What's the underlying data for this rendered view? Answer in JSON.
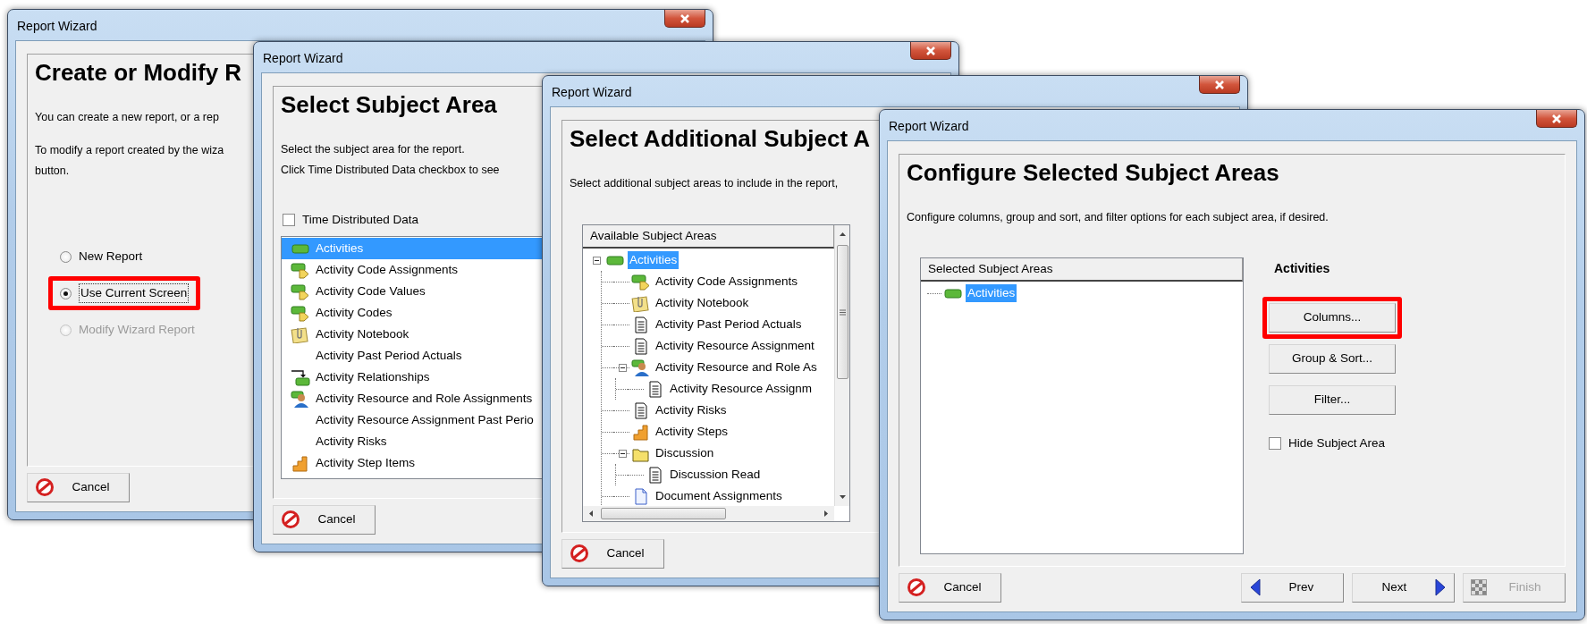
{
  "windows": [
    {
      "kind": "options",
      "title": "Report Wizard",
      "heading": "Create or Modify R",
      "paragraphs": [
        {
          "lines": [
            "You can create a new report, or a rep"
          ]
        },
        {
          "lines": [
            "To modify a report created by the wiza",
            "button."
          ]
        }
      ],
      "options": [
        {
          "label": "New Report",
          "selected": false,
          "disabled": false,
          "highlighted": false,
          "focused": false
        },
        {
          "label": "Use Current Screen",
          "selected": true,
          "disabled": false,
          "highlighted": true,
          "focused": true
        },
        {
          "label": "Modify Wizard Report",
          "selected": false,
          "disabled": true,
          "highlighted": false,
          "focused": false
        }
      ],
      "buttons": [
        {
          "kind": "cancel",
          "label": "Cancel",
          "disabled": false
        }
      ]
    },
    {
      "kind": "list",
      "title": "Report Wizard",
      "heading": "Select Subject Area",
      "paragraphs": [
        {
          "lines": [
            "Select the subject area for the report.",
            "Click Time Distributed Data checkbox to see"
          ]
        }
      ],
      "checkbox": {
        "label": "Time Distributed Data",
        "checked": false
      },
      "items": [
        {
          "label": "Activities",
          "kind": "activity",
          "selected": true
        },
        {
          "label": "Activity Code Assignments",
          "kind": "code",
          "selected": false
        },
        {
          "label": "Activity Code Values",
          "kind": "code",
          "selected": false
        },
        {
          "label": "Activity Codes",
          "kind": "code",
          "selected": false
        },
        {
          "label": "Activity Notebook",
          "kind": "notebook",
          "selected": false
        },
        {
          "label": "Activity Past Period Actuals",
          "kind": "plain",
          "selected": false
        },
        {
          "label": "Activity Relationships",
          "kind": "relationship",
          "selected": false
        },
        {
          "label": "Activity Resource and Role Assignments",
          "kind": "resource",
          "selected": false
        },
        {
          "label": "Activity Resource Assignment Past Perio",
          "kind": "plain",
          "selected": false
        },
        {
          "label": "Activity Risks",
          "kind": "plain",
          "selected": false
        },
        {
          "label": "Activity Step Items",
          "kind": "steps",
          "selected": false
        }
      ],
      "buttons": [
        {
          "kind": "cancel",
          "label": "Cancel",
          "disabled": false
        }
      ]
    },
    {
      "kind": "tree",
      "title": "Report Wizard",
      "heading": "Select Additional Subject A",
      "paragraphs": [
        {
          "lines": [
            "Select additional subject areas to include in the report,"
          ]
        }
      ],
      "tree": {
        "header": "Available Subject Areas",
        "nodes": [
          {
            "label": "Activities",
            "kind": "activity",
            "selected": true,
            "expanded": true,
            "children": [
              {
                "label": "Activity Code Assignments",
                "kind": "code",
                "selected": false
              },
              {
                "label": "Activity Notebook",
                "kind": "notebook",
                "selected": false
              },
              {
                "label": "Activity Past Period Actuals",
                "kind": "document",
                "selected": false
              },
              {
                "label": "Activity Resource Assignment",
                "kind": "document",
                "selected": false
              },
              {
                "label": "Activity Resource and Role As",
                "kind": "resource",
                "selected": false,
                "expanded": true,
                "children": [
                  {
                    "label": "Activity Resource Assignm",
                    "kind": "document",
                    "selected": false
                  }
                ]
              },
              {
                "label": "Activity Risks",
                "kind": "document",
                "selected": false
              },
              {
                "label": "Activity Steps",
                "kind": "steps",
                "selected": false
              },
              {
                "label": "Discussion",
                "kind": "folder",
                "selected": false,
                "expanded": true,
                "children": [
                  {
                    "label": "Discussion Read",
                    "kind": "document",
                    "selected": false
                  }
                ]
              },
              {
                "label": "Document Assignments",
                "kind": "assignment",
                "selected": false
              }
            ]
          }
        ]
      },
      "buttons": [
        {
          "kind": "cancel",
          "label": "Cancel",
          "disabled": false
        }
      ]
    },
    {
      "kind": "configure",
      "title": "Report Wizard",
      "heading": "Configure Selected Subject Areas",
      "paragraphs": [
        {
          "lines": [
            "Configure columns, group and sort, and filter options for each subject area, if desired."
          ]
        }
      ],
      "tree": {
        "header": "Selected Subject Areas",
        "nodes": [
          {
            "label": "Activities",
            "kind": "activity",
            "selected": true
          }
        ]
      },
      "subject": {
        "label": "Activities",
        "buttons": [
          {
            "label": "Columns...",
            "highlighted": true
          },
          {
            "label": "Group & Sort...",
            "highlighted": false
          },
          {
            "label": "Filter...",
            "highlighted": false
          }
        ],
        "checkbox": {
          "label": "Hide Subject Area",
          "checked": false
        }
      },
      "buttons": [
        {
          "kind": "cancel",
          "label": "Cancel",
          "disabled": false
        },
        {
          "kind": "prev",
          "label": "Prev",
          "disabled": false
        },
        {
          "kind": "next",
          "label": "Next",
          "disabled": false
        },
        {
          "kind": "finish",
          "label": "Finish",
          "disabled": true
        }
      ]
    }
  ]
}
